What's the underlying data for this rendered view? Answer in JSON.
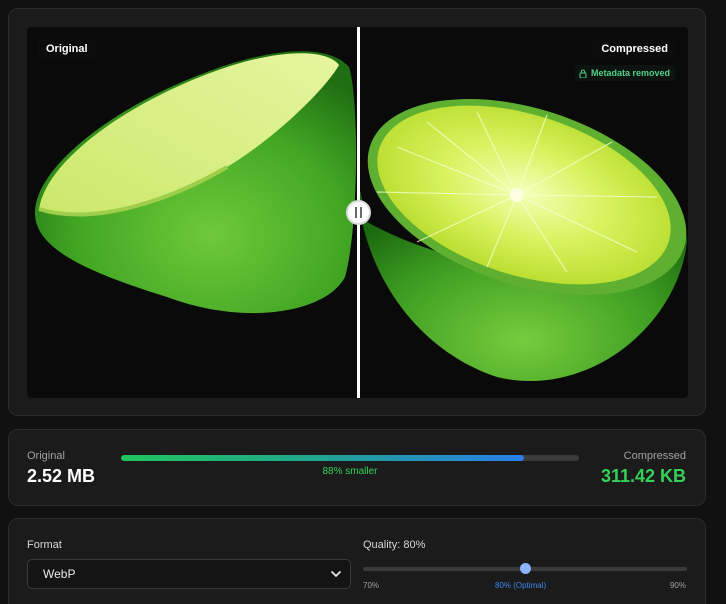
{
  "preview": {
    "original_label": "Original",
    "compressed_label": "Compressed",
    "metadata_badge": "Metadata removed",
    "icons": {
      "lock": "lock-icon",
      "handle": "drag-handle-icon"
    }
  },
  "sizes": {
    "original_label": "Original",
    "original_value": "2.52 MB",
    "compressed_label": "Compressed",
    "compressed_value": "311.42 KB",
    "savings_text": "88% smaller",
    "savings_fraction": 0.88
  },
  "settings": {
    "format_label": "Format",
    "format_value": "WebP",
    "quality_label": "Quality: 80%",
    "quality_min_label": "70%",
    "quality_optimal_label": "80% (Optimal)",
    "quality_max_label": "90%",
    "quality_value_fraction": 0.5,
    "icons": {
      "dropdown": "chevron-down-icon"
    }
  },
  "colors": {
    "accent_green": "#34d158",
    "accent_blue": "#3f86f0",
    "metadata_green": "#4fd28a"
  }
}
